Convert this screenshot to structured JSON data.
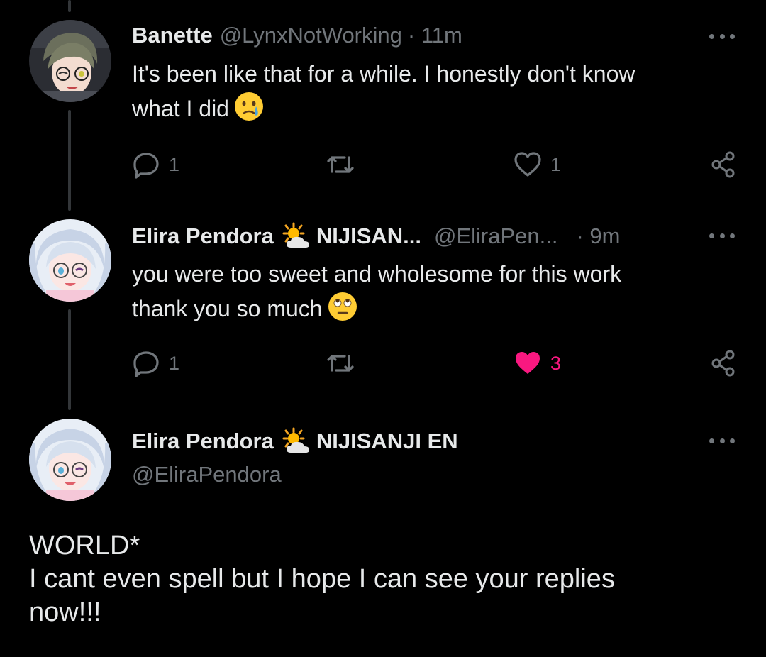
{
  "replies": [
    {
      "name": "Banette",
      "handle": "@LynxNotWorking",
      "time": "· 11m",
      "text_line1": "It's been like that for a while. I honestly don't know",
      "text_line2": "what I did",
      "reply_count": "1",
      "like_count": "1",
      "liked": false,
      "emoji": "crying-face"
    },
    {
      "name": "Elira Pendora",
      "affiliation": "NIJISAN...",
      "handle": "@EliraPen...",
      "time": "· 9m",
      "text_line1": "you were too sweet and wholesome for this work",
      "text_line2": "thank you so much",
      "reply_count": "1",
      "like_count": "3",
      "liked": true,
      "emoji": "rolling-eyes-face"
    }
  ],
  "main_post": {
    "name": "Elira Pendora",
    "affiliation": "NIJISANJI EN",
    "handle": "@EliraPendora",
    "text_line1": "WORLD*",
    "text_line2": "I cant even spell but I hope I can see your replies",
    "text_line3": "now!!!"
  },
  "colors": {
    "background": "#000000",
    "text": "#e7e9ea",
    "muted": "#71767b",
    "like": "#f91880",
    "thread_line": "#333639"
  }
}
